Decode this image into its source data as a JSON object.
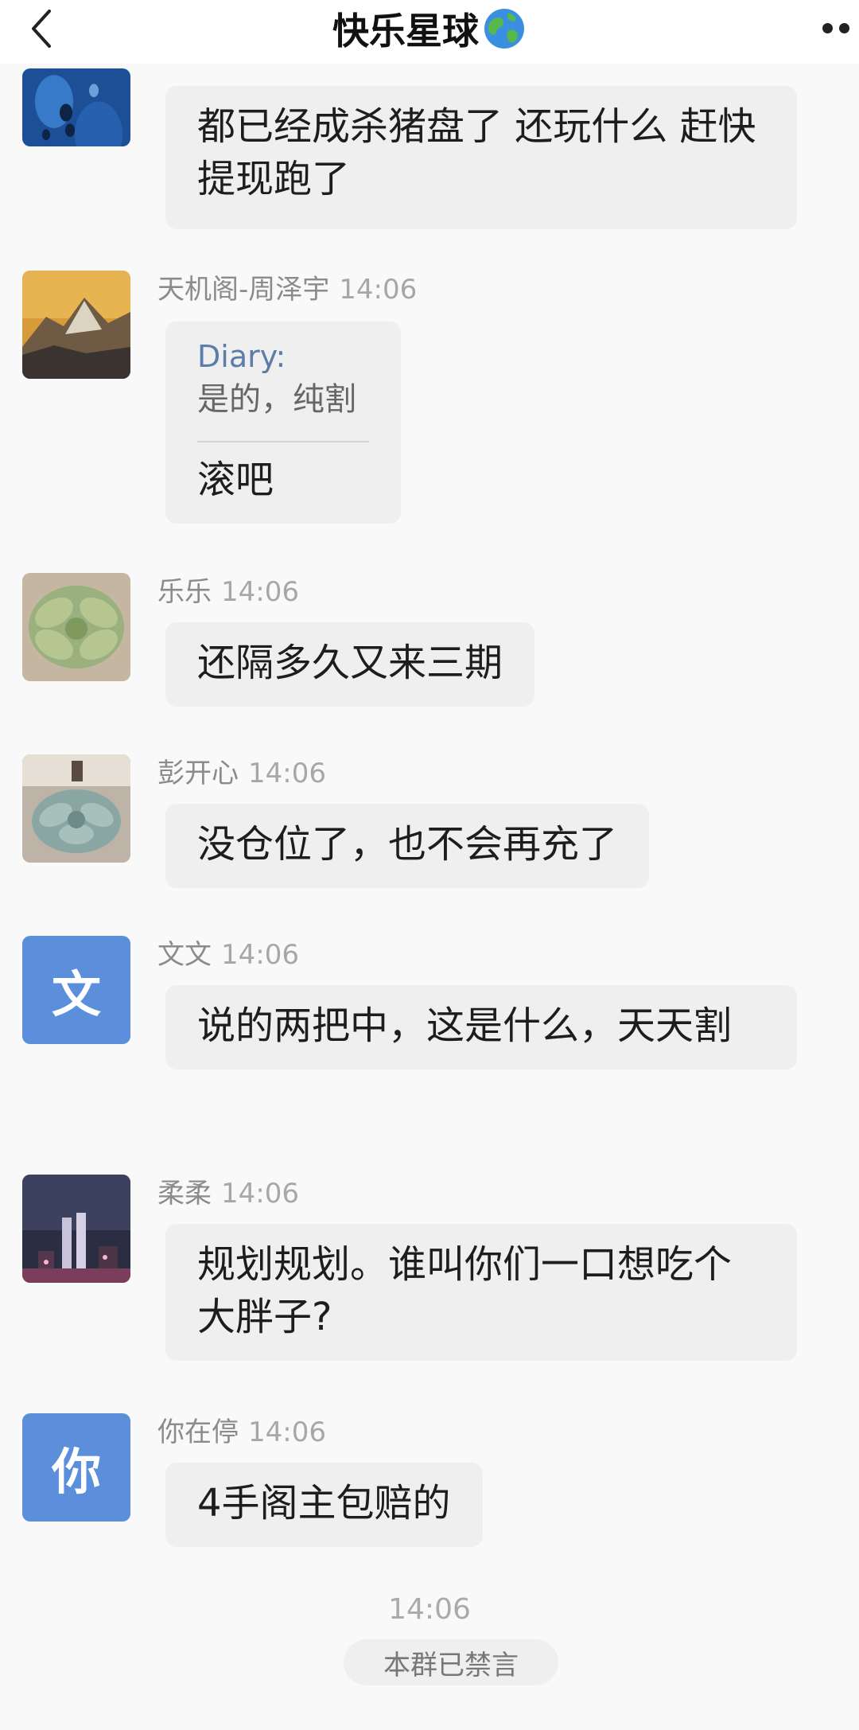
{
  "header": {
    "title": "快乐星球",
    "back_icon": "chevron-left-icon",
    "globe_icon": "globe-icon",
    "more_icon": "more-icon"
  },
  "messages": [
    {
      "text": "都已经成杀猪盘了 还玩什么 赶快提现跑了"
    },
    {
      "name": "天机阁-周泽宇",
      "time": "14:06",
      "quote_name": "Diary:",
      "quote_text": "是的，纯割",
      "text": "滚吧"
    },
    {
      "name": "乐乐",
      "time": "14:06",
      "text": "还隔多久又来三期"
    },
    {
      "name": "彭开心",
      "time": "14:06",
      "text": "没仓位了，也不会再充了"
    },
    {
      "name": "文文",
      "time": "14:06",
      "avatar_letter": "文",
      "text": "说的两把中，这是什么，天天割"
    },
    {
      "name": "柔柔",
      "time": "14:06",
      "text": "规划规划。谁叫你们一口想吃个大胖子?"
    },
    {
      "name": "你在停",
      "time": "14:06",
      "avatar_letter": "你",
      "text": "4手阁主包赔的"
    }
  ],
  "system": {
    "time": "14:06",
    "notice": "本群已禁言"
  },
  "colors": {
    "letter_avatar": "#5b8fdc",
    "bubble": "#efefef",
    "quote_name": "#5c7da7"
  }
}
